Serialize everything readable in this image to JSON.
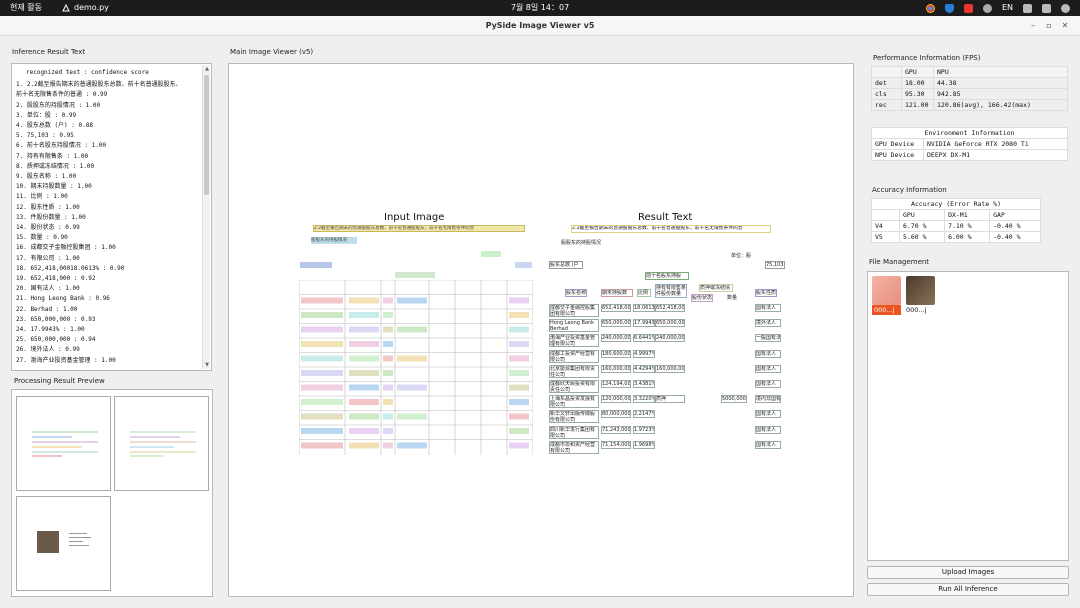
{
  "os_bar": {
    "activities": "현재 활동",
    "app_name": "demo.py",
    "clock": "7월 8일 14：07",
    "lang": "EN"
  },
  "window": {
    "title": "PySide Image Viewer v5",
    "minimize": "–",
    "maximize": "▫",
    "close": "✕"
  },
  "left": {
    "inference_label": "Inference Result Text",
    "header_line": "recognized text : confidence score",
    "lines": [
      "1. 2.2截至报告期末的普通股股东总数、前十名普通股股东、",
      "前十名无限售条件的普通 : 0.99",
      "2. 股股东的持股情况 : 1.00",
      "3. 单位：股 : 0.99",
      "4. 股东总数 (户) : 0.88",
      "5. 75,103 : 0.95",
      "6. 前十名股东持股情况 : 1.00",
      "7. 持有有限售条 : 1.00",
      "8. 质押或冻结情况 : 1.00",
      "9. 股东名称 : 1.00",
      "10. 期末持股数量 : 1.00",
      "11. 比例 : 1.00",
      "12. 股东性质 : 1.00",
      "13. 件股份数量 : 1.00",
      "14. 股份状态 : 0.99",
      "15. 数量 : 0.90",
      "16. 成都交子金融控股集团 : 1.00",
      "17. 有限公司 : 1.00",
      "18. 652,418,00018.0613% : 0.90",
      "19. 652,418,000 : 0.92",
      "20. 国有法人 : 1.00",
      "21. Hong Leong Bank : 0.96",
      "22. Berhad : 1.00",
      "23. 650,000,000 : 0.93",
      "24. 17.9943% : 1.00",
      "25. 650,000,000 : 0.94",
      "26. 境外法人 : 0.99",
      "27. 渤海产业投资基金管理 : 1.00"
    ],
    "preview_label": "Processing Result Preview"
  },
  "main": {
    "viewer_label": "Main Image Viewer (v5)",
    "input_title": "Input Image",
    "result_title": "Result Text",
    "result_texts": {
      "head": "2.2截至报告期末的普通股股东总数、前十名普通股股东、前十名无限售条件的普",
      "sub": "股股东的持股情况",
      "unit": "单位：股",
      "total_label": "股东总数 (户",
      "total_val": "75,103",
      "top10": "前十名股东持股",
      "col_name": "股东名称",
      "col_qty": "期末持股数",
      "col_ratio": "比例",
      "col_restr": "持有有限售条件股份数量",
      "col_pledge": "质押或冻结情况",
      "col_status": "股份状态",
      "col_num": "数量",
      "col_nature": "股东性质",
      "rows": [
        {
          "name": "成都交子金融控股集团有限公司",
          "qty": "652,418,000",
          "ratio": "18.0613%",
          "restr": "652,418,000",
          "nature": "国有法人"
        },
        {
          "name": "Hong Leong Bank Berhad",
          "qty": "650,000,000",
          "ratio": "17.9943%",
          "restr": "650,000,000",
          "nature": "境外法人"
        },
        {
          "name": "渤海产业投资基金管理有限公司",
          "qty": "240,000,000",
          "ratio": "6.6441%",
          "restr": "240,000,000",
          "nature": "一般国有法人"
        },
        {
          "name": "成都工投资产经营有限公司",
          "qty": "180,600,000",
          "ratio": "4.9997%",
          "restr": "",
          "nature": "国有法人"
        },
        {
          "name": "北京能源集团有限责任公司",
          "qty": "160,000,000",
          "ratio": "4.4294%",
          "restr": "160,000,000",
          "nature": "国有法人"
        },
        {
          "name": "成都欣天颐投资有限责任公司",
          "qty": "124,194,000",
          "ratio": "3.4381%",
          "restr": "",
          "nature": "国有法人"
        },
        {
          "name": "上海东昌投资发展有限公司",
          "qty": "120,000,000",
          "ratio": "3.3220%",
          "restr": "质押",
          "pledge_num": "5000,000",
          "nature": "境内非国有法人"
        },
        {
          "name": "新华文轩出版传媒股份有限公司",
          "qty": "80,000,000",
          "ratio": "2.2147%",
          "restr": "",
          "nature": "国有法人"
        },
        {
          "name": "四川新华发行集团有限公司",
          "qty": "71,243,000",
          "ratio": "1.9723%",
          "restr": "",
          "nature": "国有法人"
        },
        {
          "name": "成都市协和资产经营有限公司",
          "qty": "71,154,000",
          "ratio": "1.9698%",
          "restr": "",
          "nature": "国有法人"
        }
      ]
    }
  },
  "right": {
    "perf_label": "Performance Information (FPS)",
    "perf_headers": [
      "",
      "GPU",
      "NPU"
    ],
    "perf_rows": [
      [
        "det",
        "18.00",
        "44.38"
      ],
      [
        "cls",
        "95.30",
        "942.85"
      ],
      [
        "rec",
        "121.00",
        "120.86(avg), 166.42(max)"
      ]
    ],
    "env_title": "Environment Information",
    "env_rows": [
      [
        "GPU Device",
        "NVIDIA GeForce RTX 2080 Ti"
      ],
      [
        "NPU Device",
        "DEEPX DX-M1"
      ]
    ],
    "acc_label": "Accuracy Information",
    "acc_title": "Accuracy (Error Rate %)",
    "acc_headers": [
      "",
      "GPU",
      "DX-M1",
      "GAP"
    ],
    "acc_rows": [
      [
        "V4",
        "6.70 %",
        "7.10 %",
        "-0.40 %"
      ],
      [
        "V5",
        "5.60 %",
        "6.00 %",
        "-0.40 %"
      ]
    ],
    "file_label": "File Management",
    "files": [
      {
        "name": "000...j",
        "selected": true
      },
      {
        "name": "000...j",
        "selected": false
      }
    ],
    "upload_button": "Upload Images",
    "run_button": "Run All Inference"
  },
  "colors": {
    "accent": "#e95420",
    "topbar": "#1c1c1c"
  }
}
